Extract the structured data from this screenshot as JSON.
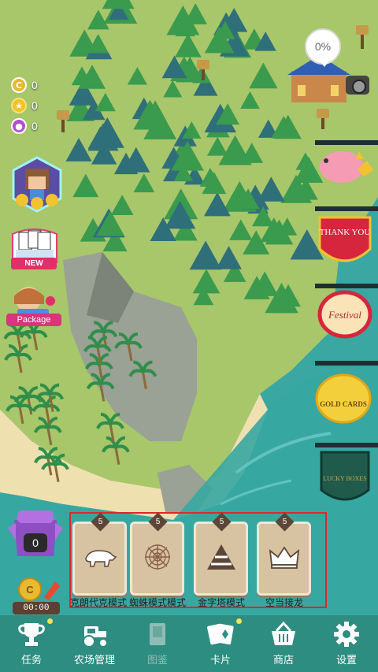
{
  "currencies": {
    "gold": "0",
    "stars": "0",
    "gems": "0"
  },
  "map_progress": "0%",
  "left_buttons": {
    "new_badge": "NEW",
    "package_label": "Package"
  },
  "signs": {
    "thank_you": "THANK YOU",
    "festival": "Festival",
    "gold_cards": "GOLD CARDS",
    "lucky_boxes": "LUCKY BOXES"
  },
  "chest": {
    "count": "0",
    "timer": "00:00"
  },
  "modes": [
    {
      "level": "5",
      "label": "克朗代克模式",
      "icon": "polar-bear-icon"
    },
    {
      "level": "5",
      "label": "蜘蛛模式模式",
      "icon": "spider-web-icon"
    },
    {
      "level": "5",
      "label": "金字塔模式",
      "icon": "pyramid-icon"
    },
    {
      "level": "5",
      "label": "空当接龙",
      "icon": "crown-icon"
    }
  ],
  "nav": [
    {
      "label": "任务",
      "icon": "trophy-icon"
    },
    {
      "label": "农场管理",
      "icon": "tractor-icon"
    },
    {
      "label": "图鉴",
      "icon": "book-icon"
    },
    {
      "label": "卡片",
      "icon": "cards-icon"
    },
    {
      "label": "商店",
      "icon": "basket-icon"
    },
    {
      "label": "设置",
      "icon": "gear-icon"
    }
  ],
  "colors": {
    "nav_bg": "#2c8d80",
    "sea": "#35a3a0",
    "grass": "#a9c96a",
    "tree": "#3a8f4a",
    "highlight": "#e0262b"
  }
}
